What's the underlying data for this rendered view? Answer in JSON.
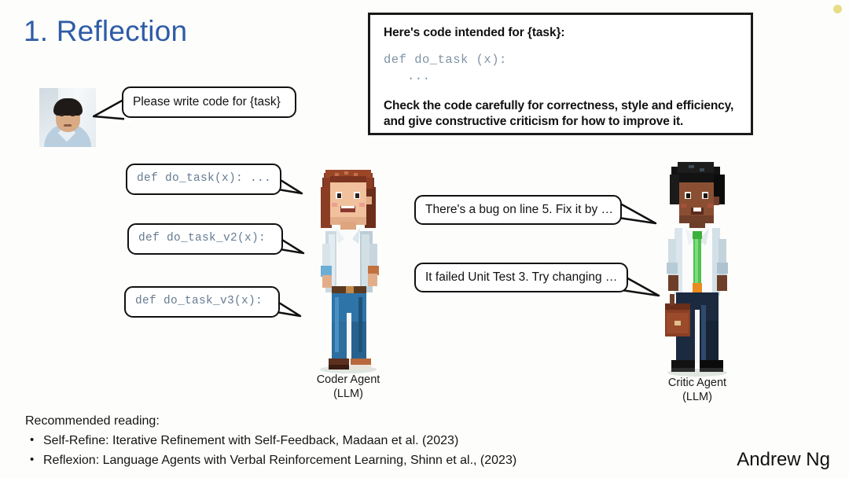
{
  "slide": {
    "title": "1. Reflection",
    "title_color": "#2e5ca8",
    "background": "#fdfdfb",
    "signature": "Andrew Ng",
    "corner_dot_color": "#e8dc85"
  },
  "user": {
    "avatar_name": "andrew-ng-headshot",
    "request_bubble": "Please write code for {task}"
  },
  "prompt_box": {
    "intro": "Here's code intended for {task}:",
    "code_line": "def do_task (x):",
    "code_ellipsis": "...",
    "instruction": "Check the code carefully for correctness, style and efficiency, and give constructive criticism for how to improve it."
  },
  "code_bubbles": [
    {
      "text": "def do_task(x): ..."
    },
    {
      "text": "def do_task_v2(x):"
    },
    {
      "text": "def do_task_v3(x):"
    }
  ],
  "critic_bubbles": [
    {
      "text": "There's a bug on line 5. Fix it by …"
    },
    {
      "text": "It failed Unit Test 3. Try changing …"
    }
  ],
  "agents": {
    "coder": {
      "name": "Coder Agent",
      "subtitle": "(LLM)"
    },
    "critic": {
      "name": "Critic Agent",
      "subtitle": "(LLM)"
    }
  },
  "footer": {
    "heading": "Recommended reading:",
    "items": [
      "Self-Refine: Iterative Refinement with Self-Feedback, Madaan et al. (2023)",
      "Reflexion: Language Agents with Verbal Reinforcement Learning, Shinn et al., (2023)"
    ]
  }
}
